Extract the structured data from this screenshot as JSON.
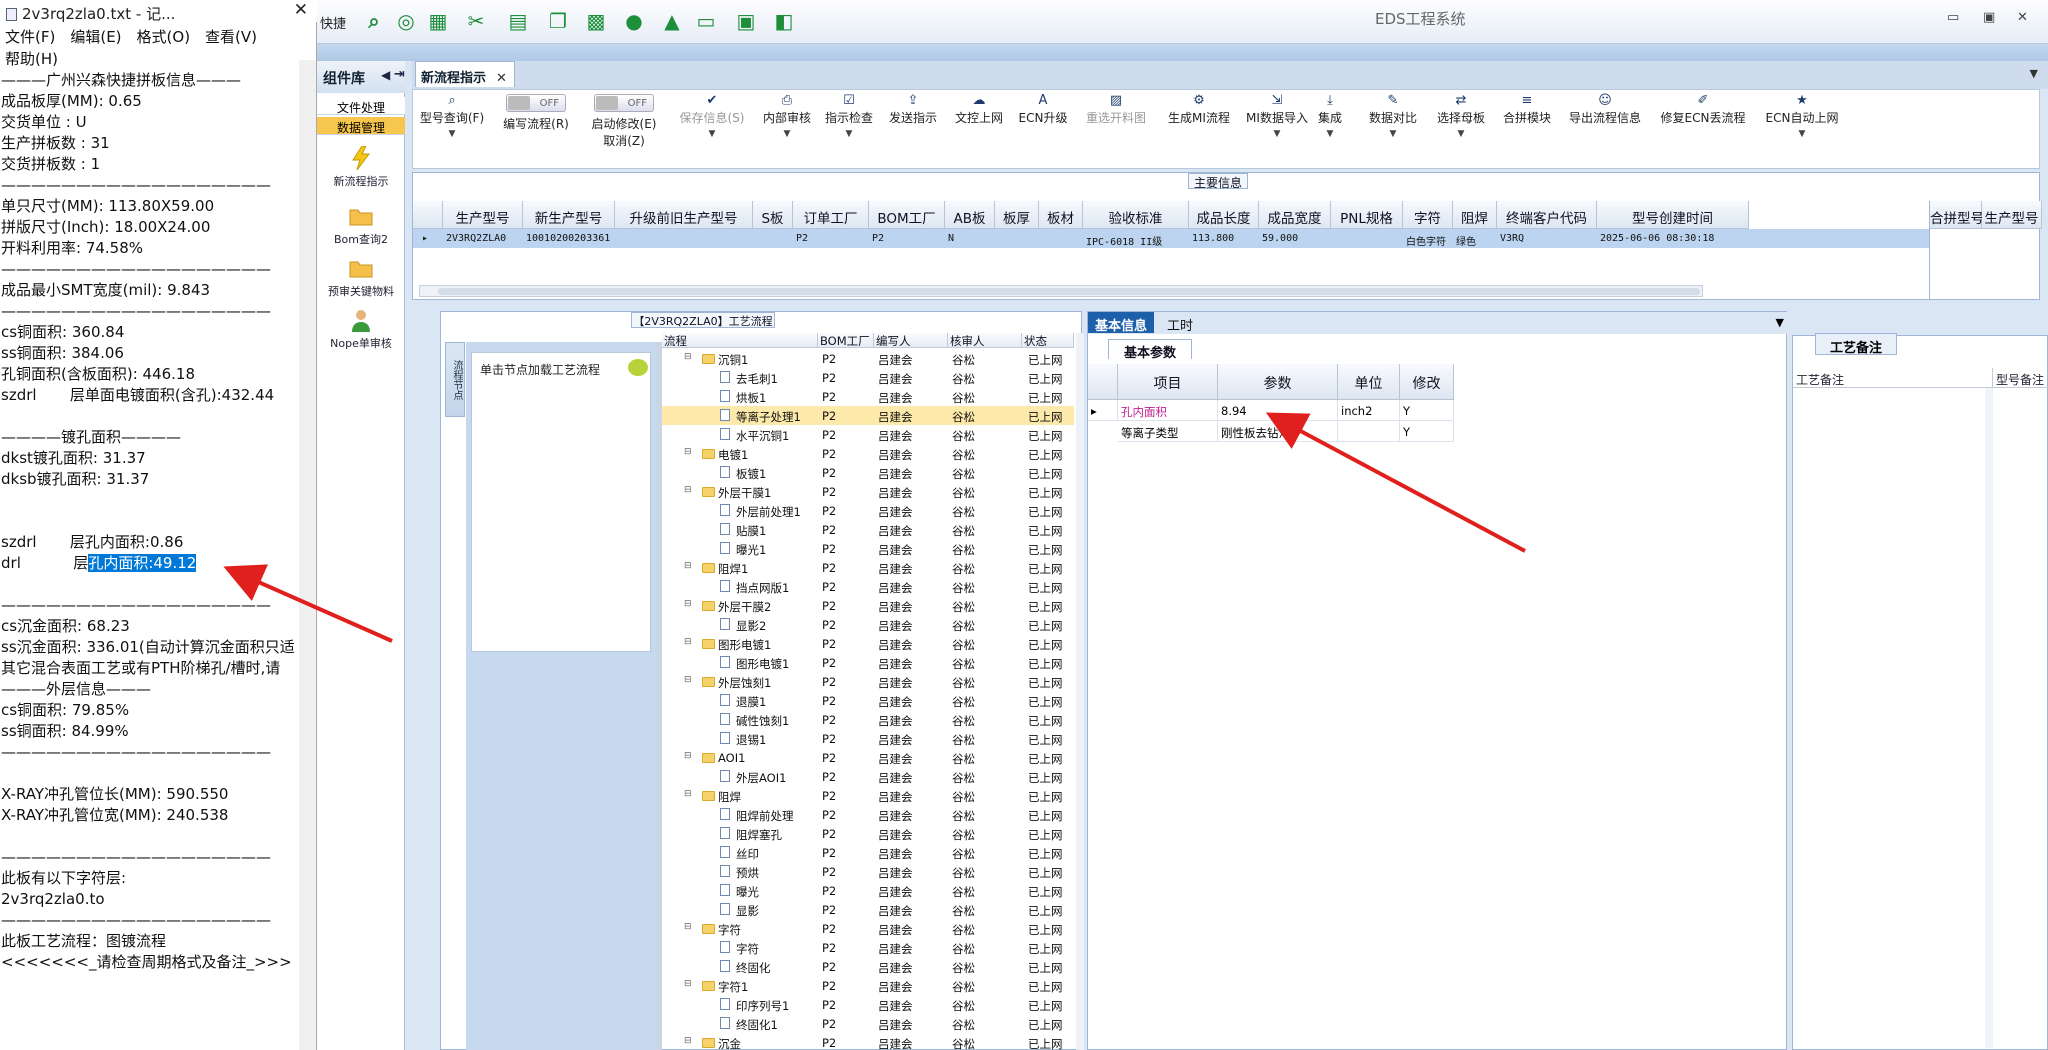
{
  "notepad": {
    "title": "2v3rq2zla0.txt - 记...",
    "menu": [
      "文件(F)",
      "编辑(E)",
      "格式(O)",
      "查看(V)",
      "帮助(H)"
    ],
    "lines": [
      "———广州兴森快捷拼板信息———",
      "成品板厚(MM): 0.65",
      "交货单位 : U",
      "生产拼板数 : 31",
      "交货拼板数 : 1",
      "——————————————————",
      "单只尺寸(MM): 113.80X59.00",
      "拼版尺寸(Inch): 18.00X24.00",
      "开料利用率: 74.58%",
      "——————————————————",
      "成品最小SMT宽度(mil): 9.843",
      "——————————————————",
      "cs铜面积: 360.84",
      "ss铜面积: 384.06",
      "孔铜面积(含板面积): 446.18",
      "szdrl       层单面电镀面积(含孔):432.44",
      "",
      "————镀孔面积————",
      "dkst镀孔面积: 31.37",
      "dksb镀孔面积: 31.37",
      "",
      "",
      "szdrl       层孔内面积:0.86",
      "drl           层",
      "",
      "——————————————————",
      "cs沉金面积: 68.23",
      "ss沉金面积: 336.01(自动计算沉金面积只适",
      "其它混合表面工艺或有PTH阶梯孔/槽时,请",
      "———外层信息———",
      "cs铜面积: 79.85%",
      "ss铜面积: 84.99%",
      "——————————————————",
      "",
      "X-RAY冲孔管位长(MM): 590.550",
      "X-RAY冲孔管位宽(MM): 240.538",
      "",
      "——————————————————",
      "此板有以下字符层:",
      "2v3rq2zla0.to",
      "——————————————————",
      "此板工艺流程：图镀流程",
      "<<<<<<<_请检查周期格式及备注_>>>"
    ],
    "selected_text": "孔内面积:49.12"
  },
  "eds": {
    "window_title": "EDS工程系统",
    "qat_label": "快捷",
    "icons": [
      "search-icon",
      "lifebuoy-icon",
      "table-icon",
      "scissors-icon",
      "film-icon",
      "copy-icon",
      "grid-icon",
      "user-icon",
      "chart-icon",
      "monitor-icon",
      "windows-icon",
      "window-icon"
    ],
    "component_lib": "组件库",
    "left_tabs": [
      "文件处理",
      "数据管理"
    ],
    "left_items": [
      "新流程指示",
      "Bom查询2",
      "预审关键物料",
      "Nope单审核"
    ],
    "doc_tab": "新流程指示",
    "toolbar": [
      {
        "label": "型号查询(F)",
        "icon": "search-icon",
        "dropdown": true
      },
      {
        "label": "编写流程(R)",
        "toggle": "OFF"
      },
      {
        "label": "启动修改(E)",
        "label2": "取消(Z)",
        "toggle": "OFF"
      },
      {
        "label": "保存信息(S)",
        "icon": "check-icon",
        "dropdown": true,
        "disabled": true
      },
      {
        "label": "内部审核",
        "icon": "printer-icon",
        "dropdown": true
      },
      {
        "label": "指示检查",
        "icon": "checkbox-icon",
        "dropdown": true
      },
      {
        "label": "发送指示",
        "icon": "upload-icon"
      },
      {
        "label": "文控上网",
        "icon": "cloud-icon"
      },
      {
        "label": "ECN升级",
        "icon": "font-icon"
      },
      {
        "label": "重选开料图",
        "icon": "image-icon",
        "disabled": true
      },
      {
        "label": "生成MI流程",
        "icon": "gears-icon"
      },
      {
        "label": "MI数据导入",
        "icon": "import-icon",
        "dropdown": true
      },
      {
        "label": "集成",
        "icon": "download-icon",
        "dropdown": true
      },
      {
        "label": "数据对比",
        "icon": "magic-icon",
        "dropdown": true
      },
      {
        "label": "选择母板",
        "icon": "shuffle-icon",
        "dropdown": true
      },
      {
        "label": "合拼模块",
        "icon": "list-icon"
      },
      {
        "label": "导出流程信息",
        "icon": "smile-icon"
      },
      {
        "label": "修复ECN丢流程",
        "icon": "wrench-icon"
      },
      {
        "label": "ECN自动上网",
        "icon": "star-icon",
        "dropdown": true
      }
    ],
    "main_info": {
      "caption": "主要信息",
      "columns": [
        "生产型号",
        "新生产型号",
        "升级前旧生产型号",
        "S板",
        "订单工厂",
        "BOM工厂",
        "AB板",
        "板厚",
        "板材",
        "验收标准",
        "成品长度",
        "成品宽度",
        "PNL规格",
        "字符",
        "阻焊",
        "终端客户代码",
        "型号创建时间"
      ],
      "row": [
        "2V3RQ2ZLA0",
        "10010200203361",
        "",
        "",
        "P2",
        "P2",
        "N",
        "",
        "",
        "IPC-6018 II级",
        "113.800",
        "59.000",
        "",
        "白色字符",
        "绿色",
        "V3RQ",
        "2025-06-06 08:30:18"
      ],
      "right_columns": [
        "合拼型号",
        "生产型号"
      ]
    },
    "process_flow": {
      "caption": "【2V3RQ2ZLA0】工艺流程",
      "side_tab": "流程节点",
      "node_hint": "单击节点加载工艺流程",
      "columns": [
        "流程",
        "BOM工厂",
        "编写人",
        "核审人",
        "状态"
      ],
      "rows": [
        {
          "name": "沉铜1",
          "level": 0,
          "bom": "P2",
          "writer": "吕建会",
          "reviewer": "谷松",
          "status": "已上网"
        },
        {
          "name": "去毛刺1",
          "level": 1,
          "bom": "P2",
          "writer": "吕建会",
          "reviewer": "谷松",
          "status": "已上网"
        },
        {
          "name": "烘板1",
          "level": 1,
          "bom": "P2",
          "writer": "吕建会",
          "reviewer": "谷松",
          "status": "已上网"
        },
        {
          "name": "等离子处理1",
          "level": 1,
          "bom": "P2",
          "writer": "吕建会",
          "reviewer": "谷松",
          "status": "已上网",
          "selected": true
        },
        {
          "name": "水平沉铜1",
          "level": 1,
          "bom": "P2",
          "writer": "吕建会",
          "reviewer": "谷松",
          "status": "已上网"
        },
        {
          "name": "电镀1",
          "level": 0,
          "bom": "P2",
          "writer": "吕建会",
          "reviewer": "谷松",
          "status": "已上网"
        },
        {
          "name": "板镀1",
          "level": 1,
          "bom": "P2",
          "writer": "吕建会",
          "reviewer": "谷松",
          "status": "已上网"
        },
        {
          "name": "外层干膜1",
          "level": 0,
          "bom": "P2",
          "writer": "吕建会",
          "reviewer": "谷松",
          "status": "已上网"
        },
        {
          "name": "外层前处理1",
          "level": 1,
          "bom": "P2",
          "writer": "吕建会",
          "reviewer": "谷松",
          "status": "已上网"
        },
        {
          "name": "贴膜1",
          "level": 1,
          "bom": "P2",
          "writer": "吕建会",
          "reviewer": "谷松",
          "status": "已上网"
        },
        {
          "name": "曝光1",
          "level": 1,
          "bom": "P2",
          "writer": "吕建会",
          "reviewer": "谷松",
          "status": "已上网"
        },
        {
          "name": "阻焊1",
          "level": 0,
          "bom": "P2",
          "writer": "吕建会",
          "reviewer": "谷松",
          "status": "已上网"
        },
        {
          "name": "挡点网版1",
          "level": 1,
          "bom": "P2",
          "writer": "吕建会",
          "reviewer": "谷松",
          "status": "已上网"
        },
        {
          "name": "外层干膜2",
          "level": 0,
          "bom": "P2",
          "writer": "吕建会",
          "reviewer": "谷松",
          "status": "已上网"
        },
        {
          "name": "显影2",
          "level": 1,
          "bom": "P2",
          "writer": "吕建会",
          "reviewer": "谷松",
          "status": "已上网"
        },
        {
          "name": "图形电镀1",
          "level": 0,
          "bom": "P2",
          "writer": "吕建会",
          "reviewer": "谷松",
          "status": "已上网"
        },
        {
          "name": "图形电镀1",
          "level": 1,
          "bom": "P2",
          "writer": "吕建会",
          "reviewer": "谷松",
          "status": "已上网"
        },
        {
          "name": "外层蚀刻1",
          "level": 0,
          "bom": "P2",
          "writer": "吕建会",
          "reviewer": "谷松",
          "status": "已上网"
        },
        {
          "name": "退膜1",
          "level": 1,
          "bom": "P2",
          "writer": "吕建会",
          "reviewer": "谷松",
          "status": "已上网"
        },
        {
          "name": "碱性蚀刻1",
          "level": 1,
          "bom": "P2",
          "writer": "吕建会",
          "reviewer": "谷松",
          "status": "已上网"
        },
        {
          "name": "退锡1",
          "level": 1,
          "bom": "P2",
          "writer": "吕建会",
          "reviewer": "谷松",
          "status": "已上网"
        },
        {
          "name": "AOI1",
          "level": 0,
          "bom": "P2",
          "writer": "吕建会",
          "reviewer": "谷松",
          "status": "已上网"
        },
        {
          "name": "外层AOI1",
          "level": 1,
          "bom": "P2",
          "writer": "吕建会",
          "reviewer": "谷松",
          "status": "已上网"
        },
        {
          "name": "阻焊",
          "level": 0,
          "bom": "P2",
          "writer": "吕建会",
          "reviewer": "谷松",
          "status": "已上网"
        },
        {
          "name": "阻焊前处理",
          "level": 1,
          "bom": "P2",
          "writer": "吕建会",
          "reviewer": "谷松",
          "status": "已上网"
        },
        {
          "name": "阻焊塞孔",
          "level": 1,
          "bom": "P2",
          "writer": "吕建会",
          "reviewer": "谷松",
          "status": "已上网"
        },
        {
          "name": "丝印",
          "level": 1,
          "bom": "P2",
          "writer": "吕建会",
          "reviewer": "谷松",
          "status": "已上网"
        },
        {
          "name": "预烘",
          "level": 1,
          "bom": "P2",
          "writer": "吕建会",
          "reviewer": "谷松",
          "status": "已上网"
        },
        {
          "name": "曝光",
          "level": 1,
          "bom": "P2",
          "writer": "吕建会",
          "reviewer": "谷松",
          "status": "已上网"
        },
        {
          "name": "显影",
          "level": 1,
          "bom": "P2",
          "writer": "吕建会",
          "reviewer": "谷松",
          "status": "已上网"
        },
        {
          "name": "字符",
          "level": 0,
          "bom": "P2",
          "writer": "吕建会",
          "reviewer": "谷松",
          "status": "已上网"
        },
        {
          "name": "字符",
          "level": 1,
          "bom": "P2",
          "writer": "吕建会",
          "reviewer": "谷松",
          "status": "已上网"
        },
        {
          "name": "终固化",
          "level": 1,
          "bom": "P2",
          "writer": "吕建会",
          "reviewer": "谷松",
          "status": "已上网"
        },
        {
          "name": "字符1",
          "level": 0,
          "bom": "P2",
          "writer": "吕建会",
          "reviewer": "谷松",
          "status": "已上网"
        },
        {
          "name": "印序列号1",
          "level": 1,
          "bom": "P2",
          "writer": "吕建会",
          "reviewer": "谷松",
          "status": "已上网"
        },
        {
          "name": "终固化1",
          "level": 1,
          "bom": "P2",
          "writer": "吕建会",
          "reviewer": "谷松",
          "status": "已上网"
        },
        {
          "name": "沉金",
          "level": 0,
          "bom": "P2",
          "writer": "吕建会",
          "reviewer": "谷松",
          "status": "已上网"
        }
      ]
    },
    "basic_info": {
      "tabs": [
        "基本信息",
        "工时"
      ],
      "sub_tab": "基本参数",
      "columns": [
        "项目",
        "参数",
        "单位",
        "修改"
      ],
      "rows": [
        {
          "item": "孔内面积",
          "param": "8.94",
          "unit": "inch2",
          "modify": "Y"
        },
        {
          "item": "等离子类型",
          "param": "刚性板去钻污",
          "unit": "",
          "modify": "Y"
        }
      ]
    },
    "remarks": {
      "caption": "工艺备注",
      "columns": [
        "工艺备注",
        "型号备注"
      ]
    }
  }
}
